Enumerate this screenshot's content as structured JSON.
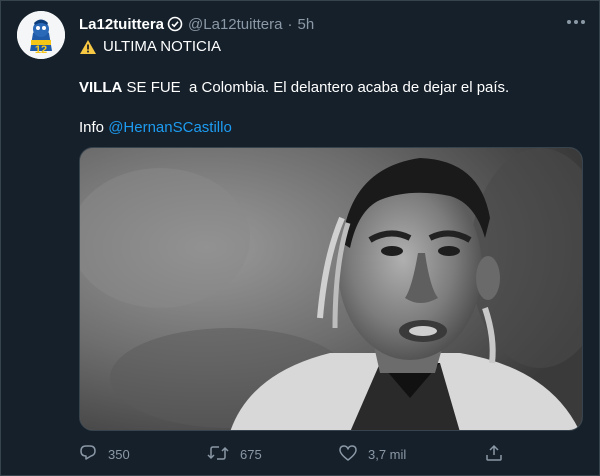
{
  "tweet": {
    "display_name": "La12tuittera",
    "handle": "@La12tuittera",
    "separator": "·",
    "time": "5h",
    "line1_text": "ULTIMA NOTICIA",
    "line2_bold": "VILLA",
    "line2_rest": " SE FUE  a Colombia. El delantero acaba de dejar el país.",
    "line3_prefix": "Info ",
    "line3_link": "@HernanSCastillo",
    "avatar_text": "12"
  },
  "actions": {
    "replies": "350",
    "retweets": "675",
    "likes": "3,7 mil"
  },
  "icons": {
    "verified": "verified-badge-icon",
    "warning": "warning-sign-icon",
    "more": "more-options-icon",
    "reply": "reply-icon",
    "retweet": "retweet-icon",
    "like": "heart-icon",
    "share": "share-icon"
  },
  "colors": {
    "background": "#15202b",
    "link": "#1d9bf0",
    "muted": "#8b98a5",
    "border": "#38444d"
  }
}
